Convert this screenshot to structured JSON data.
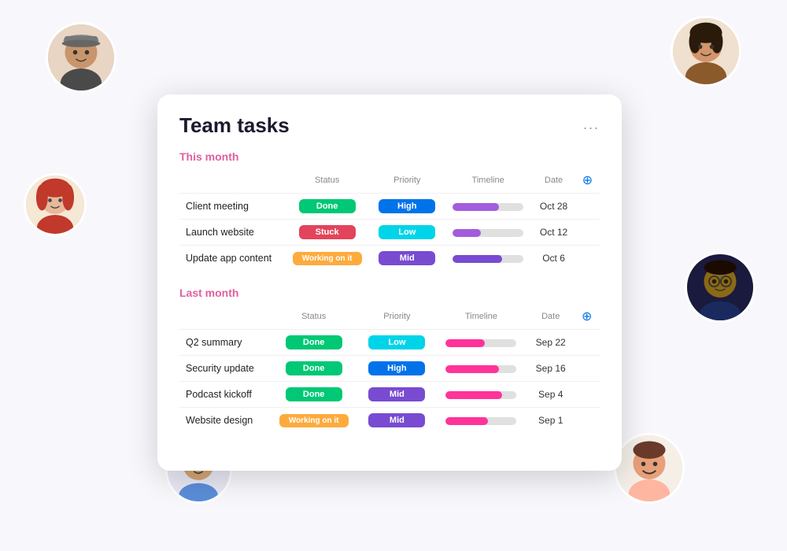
{
  "title": "Team tasks",
  "menu": "...",
  "section1": {
    "label": "This month",
    "columns": [
      "Status",
      "Priority",
      "Timeline",
      "Date"
    ],
    "rows": [
      {
        "name": "Client meeting",
        "status": "Done",
        "status_type": "done",
        "priority": "High",
        "priority_type": "high",
        "timeline_pct": 65,
        "timeline_color": "purple",
        "date": "Oct 28"
      },
      {
        "name": "Launch website",
        "status": "Stuck",
        "status_type": "stuck",
        "priority": "Low",
        "priority_type": "low",
        "timeline_pct": 40,
        "timeline_color": "purple",
        "date": "Oct 12"
      },
      {
        "name": "Update app content",
        "status": "Working on it",
        "status_type": "working",
        "priority": "Mid",
        "priority_type": "mid",
        "timeline_pct": 70,
        "timeline_color": "violet",
        "date": "Oct 6"
      }
    ]
  },
  "section2": {
    "label": "Last month",
    "columns": [
      "Status",
      "Priority",
      "Timeline",
      "Date"
    ],
    "rows": [
      {
        "name": "Q2 summary",
        "status": "Done",
        "status_type": "done",
        "priority": "Low",
        "priority_type": "low",
        "timeline_pct": 55,
        "timeline_color": "pink",
        "date": "Sep 22"
      },
      {
        "name": "Security update",
        "status": "Done",
        "status_type": "done",
        "priority": "High",
        "priority_type": "high",
        "timeline_pct": 75,
        "timeline_color": "pink",
        "date": "Sep 16"
      },
      {
        "name": "Podcast kickoff",
        "status": "Done",
        "status_type": "done",
        "priority": "Mid",
        "priority_type": "mid",
        "timeline_pct": 80,
        "timeline_color": "pink",
        "date": "Sep 4"
      },
      {
        "name": "Website design",
        "status": "Working on it",
        "status_type": "working",
        "priority": "Mid",
        "priority_type": "mid",
        "timeline_pct": 60,
        "timeline_color": "pink",
        "date": "Sep 1"
      }
    ]
  },
  "avatars": [
    {
      "id": "av-tl",
      "label": "Avatar top-left"
    },
    {
      "id": "av-tr",
      "label": "Avatar top-right"
    },
    {
      "id": "av-ml",
      "label": "Avatar middle-left"
    },
    {
      "id": "av-mr",
      "label": "Avatar middle-right"
    },
    {
      "id": "av-bl",
      "label": "Avatar bottom-left"
    },
    {
      "id": "av-br",
      "label": "Avatar bottom-right"
    }
  ]
}
